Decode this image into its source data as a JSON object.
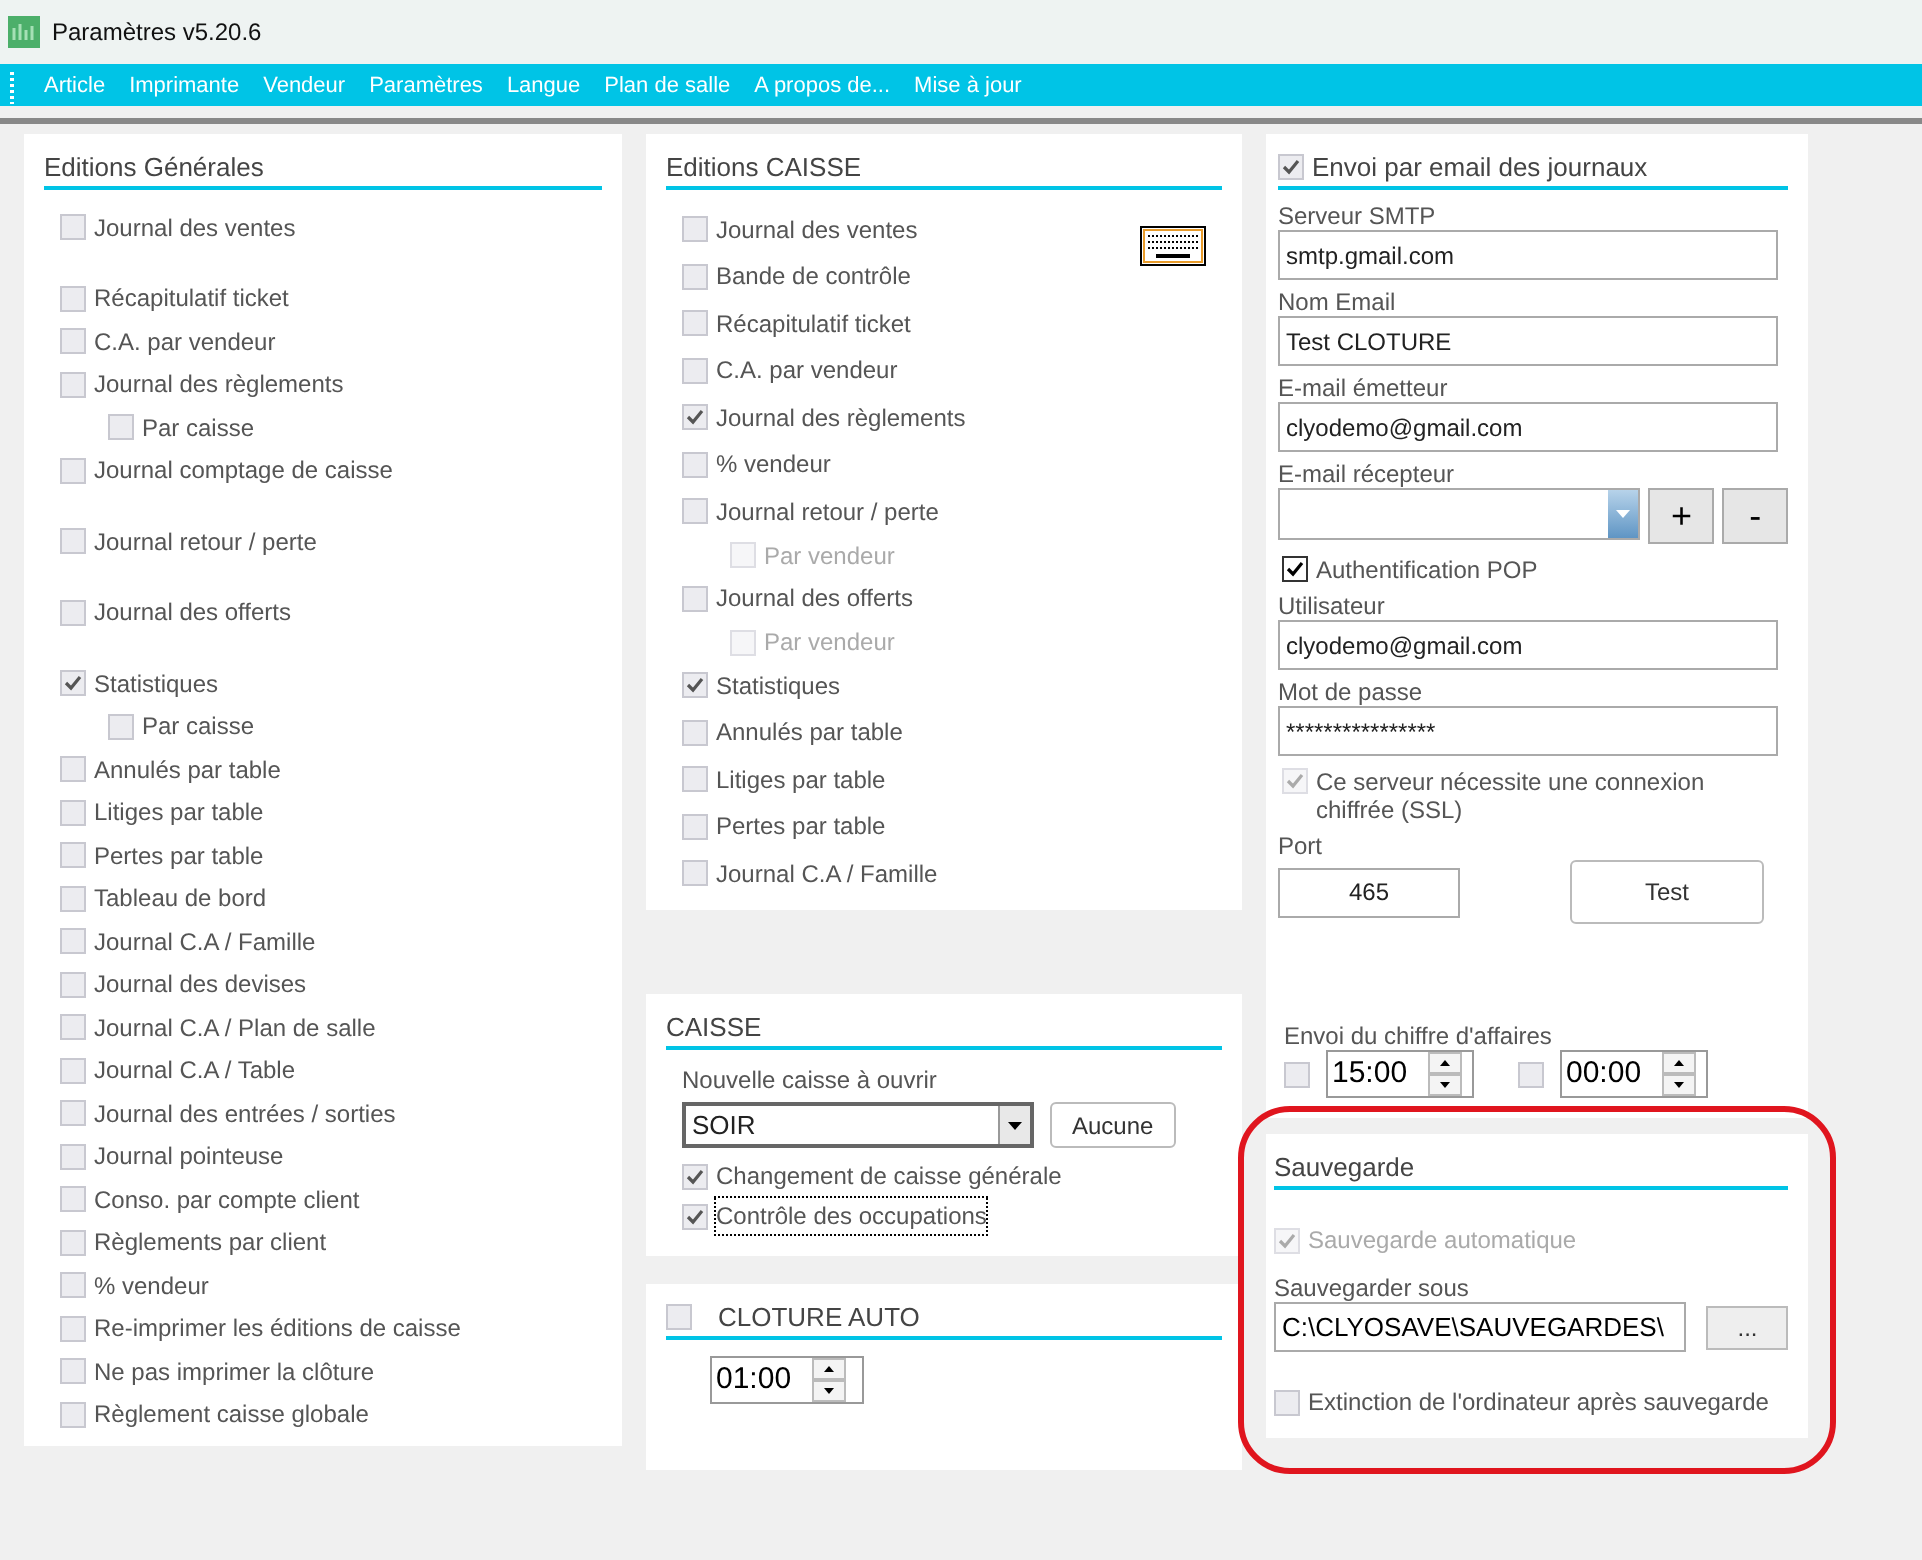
{
  "window": {
    "title": "Paramètres v5.20.6"
  },
  "menu": [
    "Article",
    "Imprimante",
    "Vendeur",
    "Paramètres",
    "Langue",
    "Plan de salle",
    "A propos de...",
    "Mise à jour"
  ],
  "editions_generales": {
    "title": "Editions Générales",
    "items": [
      {
        "label": "Journal des ventes",
        "checked": false,
        "disabled": false
      },
      {
        "label": "Récapitulatif ticket",
        "checked": false,
        "disabled": false
      },
      {
        "label": "C.A. par vendeur",
        "checked": false,
        "disabled": false
      },
      {
        "label": "Journal des règlements",
        "checked": false,
        "disabled": false,
        "children": [
          {
            "label": "Par caisse",
            "checked": false,
            "disabled": false
          }
        ]
      },
      {
        "label": "Journal comptage de caisse",
        "checked": false,
        "disabled": false
      },
      {
        "label": "Journal retour / perte",
        "checked": false,
        "disabled": false
      },
      {
        "label": "Journal des offerts",
        "checked": false,
        "disabled": false
      },
      {
        "label": "Statistiques",
        "checked": true,
        "disabled": false,
        "children": [
          {
            "label": "Par caisse",
            "checked": false,
            "disabled": false
          }
        ]
      },
      {
        "label": "Annulés par table",
        "checked": false,
        "disabled": false
      },
      {
        "label": "Litiges par table",
        "checked": false,
        "disabled": false
      },
      {
        "label": "Pertes par table",
        "checked": false,
        "disabled": false
      },
      {
        "label": "Tableau de bord",
        "checked": false,
        "disabled": false
      },
      {
        "label": "Journal C.A / Famille",
        "checked": false,
        "disabled": false
      },
      {
        "label": "Journal des devises",
        "checked": false,
        "disabled": false
      },
      {
        "label": "Journal C.A / Plan de salle",
        "checked": false,
        "disabled": false
      },
      {
        "label": "Journal C.A / Table",
        "checked": false,
        "disabled": false
      },
      {
        "label": "Journal des entrées / sorties",
        "checked": false,
        "disabled": false
      },
      {
        "label": "Journal pointeuse",
        "checked": false,
        "disabled": false
      },
      {
        "label": "Conso. par compte client",
        "checked": false,
        "disabled": false
      },
      {
        "label": "Règlements par client",
        "checked": false,
        "disabled": false
      },
      {
        "label": "% vendeur",
        "checked": false,
        "disabled": false
      },
      {
        "label": "Re-imprimer les éditions de caisse",
        "checked": false,
        "disabled": false
      },
      {
        "label": "Ne pas imprimer la clôture",
        "checked": false,
        "disabled": false
      },
      {
        "label": "Règlement caisse globale",
        "checked": false,
        "disabled": false
      }
    ]
  },
  "editions_caisse": {
    "title": "Editions CAISSE",
    "items": [
      {
        "label": "Journal des ventes",
        "checked": false,
        "disabled": false
      },
      {
        "label": "Bande de contrôle",
        "checked": false,
        "disabled": false
      },
      {
        "label": "Récapitulatif ticket",
        "checked": false,
        "disabled": false
      },
      {
        "label": "C.A. par vendeur",
        "checked": false,
        "disabled": false
      },
      {
        "label": "Journal des règlements",
        "checked": true,
        "disabled": false
      },
      {
        "label": "% vendeur",
        "checked": false,
        "disabled": false
      },
      {
        "label": "Journal retour / perte",
        "checked": false,
        "disabled": false,
        "children": [
          {
            "label": "Par vendeur",
            "checked": false,
            "disabled": true
          }
        ]
      },
      {
        "label": "Journal des offerts",
        "checked": false,
        "disabled": false,
        "children": [
          {
            "label": "Par vendeur",
            "checked": false,
            "disabled": true
          }
        ]
      },
      {
        "label": "Statistiques",
        "checked": true,
        "disabled": false
      },
      {
        "label": "Annulés par table",
        "checked": false,
        "disabled": false
      },
      {
        "label": "Litiges par table",
        "checked": false,
        "disabled": false
      },
      {
        "label": "Pertes par table",
        "checked": false,
        "disabled": false
      },
      {
        "label": "Journal C.A / Famille",
        "checked": false,
        "disabled": false
      }
    ]
  },
  "caisse": {
    "title": "CAISSE",
    "select_label": "Nouvelle caisse à ouvrir",
    "select_value": "SOIR",
    "button": "Aucune",
    "options": [
      {
        "label": "Changement de caisse générale",
        "checked": true,
        "focused": false
      },
      {
        "label": "Contrôle des occupations",
        "checked": true,
        "focused": true
      }
    ]
  },
  "cloture_auto": {
    "title": "CLOTURE AUTO",
    "checked": false,
    "time": "01:00"
  },
  "email": {
    "title": "Envoi par email des journaux",
    "checked": true,
    "fields": [
      {
        "kind": "text",
        "label": "Serveur SMTP",
        "value": "smtp.gmail.com"
      },
      {
        "kind": "text",
        "label": "Nom Email",
        "value": "Test CLOTURE"
      },
      {
        "kind": "text",
        "label": "E-mail émetteur",
        "value": "clyodemo@gmail.com"
      },
      {
        "kind": "combo",
        "label": "E-mail récepteur",
        "buttons": [
          "+",
          "-"
        ]
      },
      {
        "kind": "checkbox",
        "label": "Authentification POP",
        "checked": true,
        "disabled": false
      },
      {
        "kind": "text",
        "label": "Utilisateur",
        "value": "clyodemo@gmail.com"
      },
      {
        "kind": "text",
        "label": "Mot de passe",
        "value": "****************"
      },
      {
        "kind": "checkbox",
        "label": "Ce serveur nécessite une connexion chiffrée (SSL)",
        "checked": true,
        "disabled": true
      }
    ],
    "port_label": "Port",
    "port": "465",
    "test_button": "Test",
    "turnover": {
      "label": "Envoi du chiffre d'affaires",
      "timers": [
        {
          "checked": false,
          "time": "15:00"
        },
        {
          "checked": false,
          "time": "00:00"
        }
      ]
    }
  },
  "sauvegarde": {
    "title": "Sauvegarde",
    "highlighted": true,
    "auto": {
      "label": "Sauvegarde automatique",
      "checked": true,
      "disabled": true
    },
    "path_label": "Sauvegarder sous",
    "path": "C:\\CLYOSAVE\\SAUVEGARDES\\",
    "browse_button": "...",
    "shutdown": {
      "label": "Extinction de l'ordinateur après sauvegarde",
      "checked": false,
      "disabled": false
    }
  }
}
